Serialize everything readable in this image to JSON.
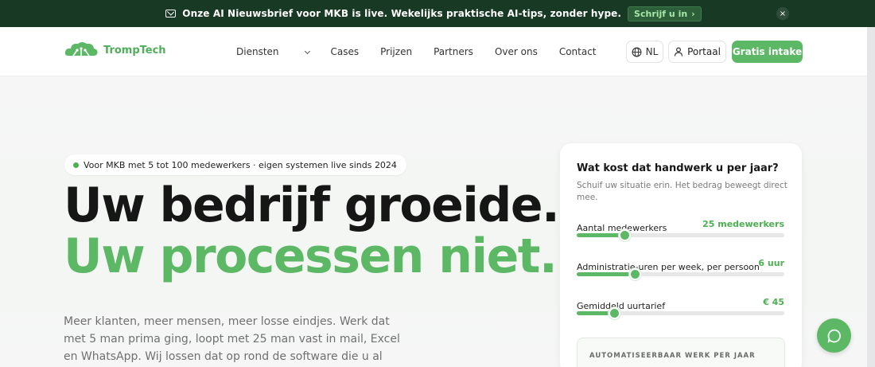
{
  "announcement": {
    "message": "Onze AI Nieuwsbrief voor MKB is live. Wekelijks praktische AI-tips, zonder hype.",
    "cta": "Schrijf u in",
    "close": "×"
  },
  "nav": {
    "logo": "TrompTech",
    "items": [
      "Diensten",
      "Cases",
      "Prijzen",
      "Partners",
      "Over ons",
      "Contact"
    ],
    "language": "NL",
    "portal": "Portaal",
    "cta": "Gratis intake"
  },
  "hero": {
    "badge": "Voor MKB met 5 tot 100 medewerkers · eigen systemen live sinds 2024",
    "title_line1": "Uw bedrijf groeide.",
    "title_line2": "Uw processen niet.",
    "lead": "Meer klanten, meer mensen, meer losse eindjes. Werk dat met 5 man prima ging, loopt met 25 man vast in mail, Excel en WhatsApp. Wij lossen dat op rond de software die u al gebruikt, zonder dat uw"
  },
  "calculator": {
    "title": "Wat kost dat handwerk u per jaar?",
    "description": "Schuif uw situatie erin. Het bedrag beweegt direct mee.",
    "sliders": [
      {
        "label": "Aantal medewerkers",
        "value": "25 medewerkers",
        "fraction": 0.23
      },
      {
        "label": "Administratie-uren per week, per persoon",
        "value": "6 uur",
        "fraction": 0.28
      },
      {
        "label": "Gemiddeld uurtarief",
        "value": "€ 45",
        "fraction": 0.18
      }
    ],
    "result_caption": "AUTOMATISEERBAAR WERK PER JAAR"
  },
  "colors": {
    "brand_green": "#5cb865",
    "topbar": "#183a24"
  }
}
